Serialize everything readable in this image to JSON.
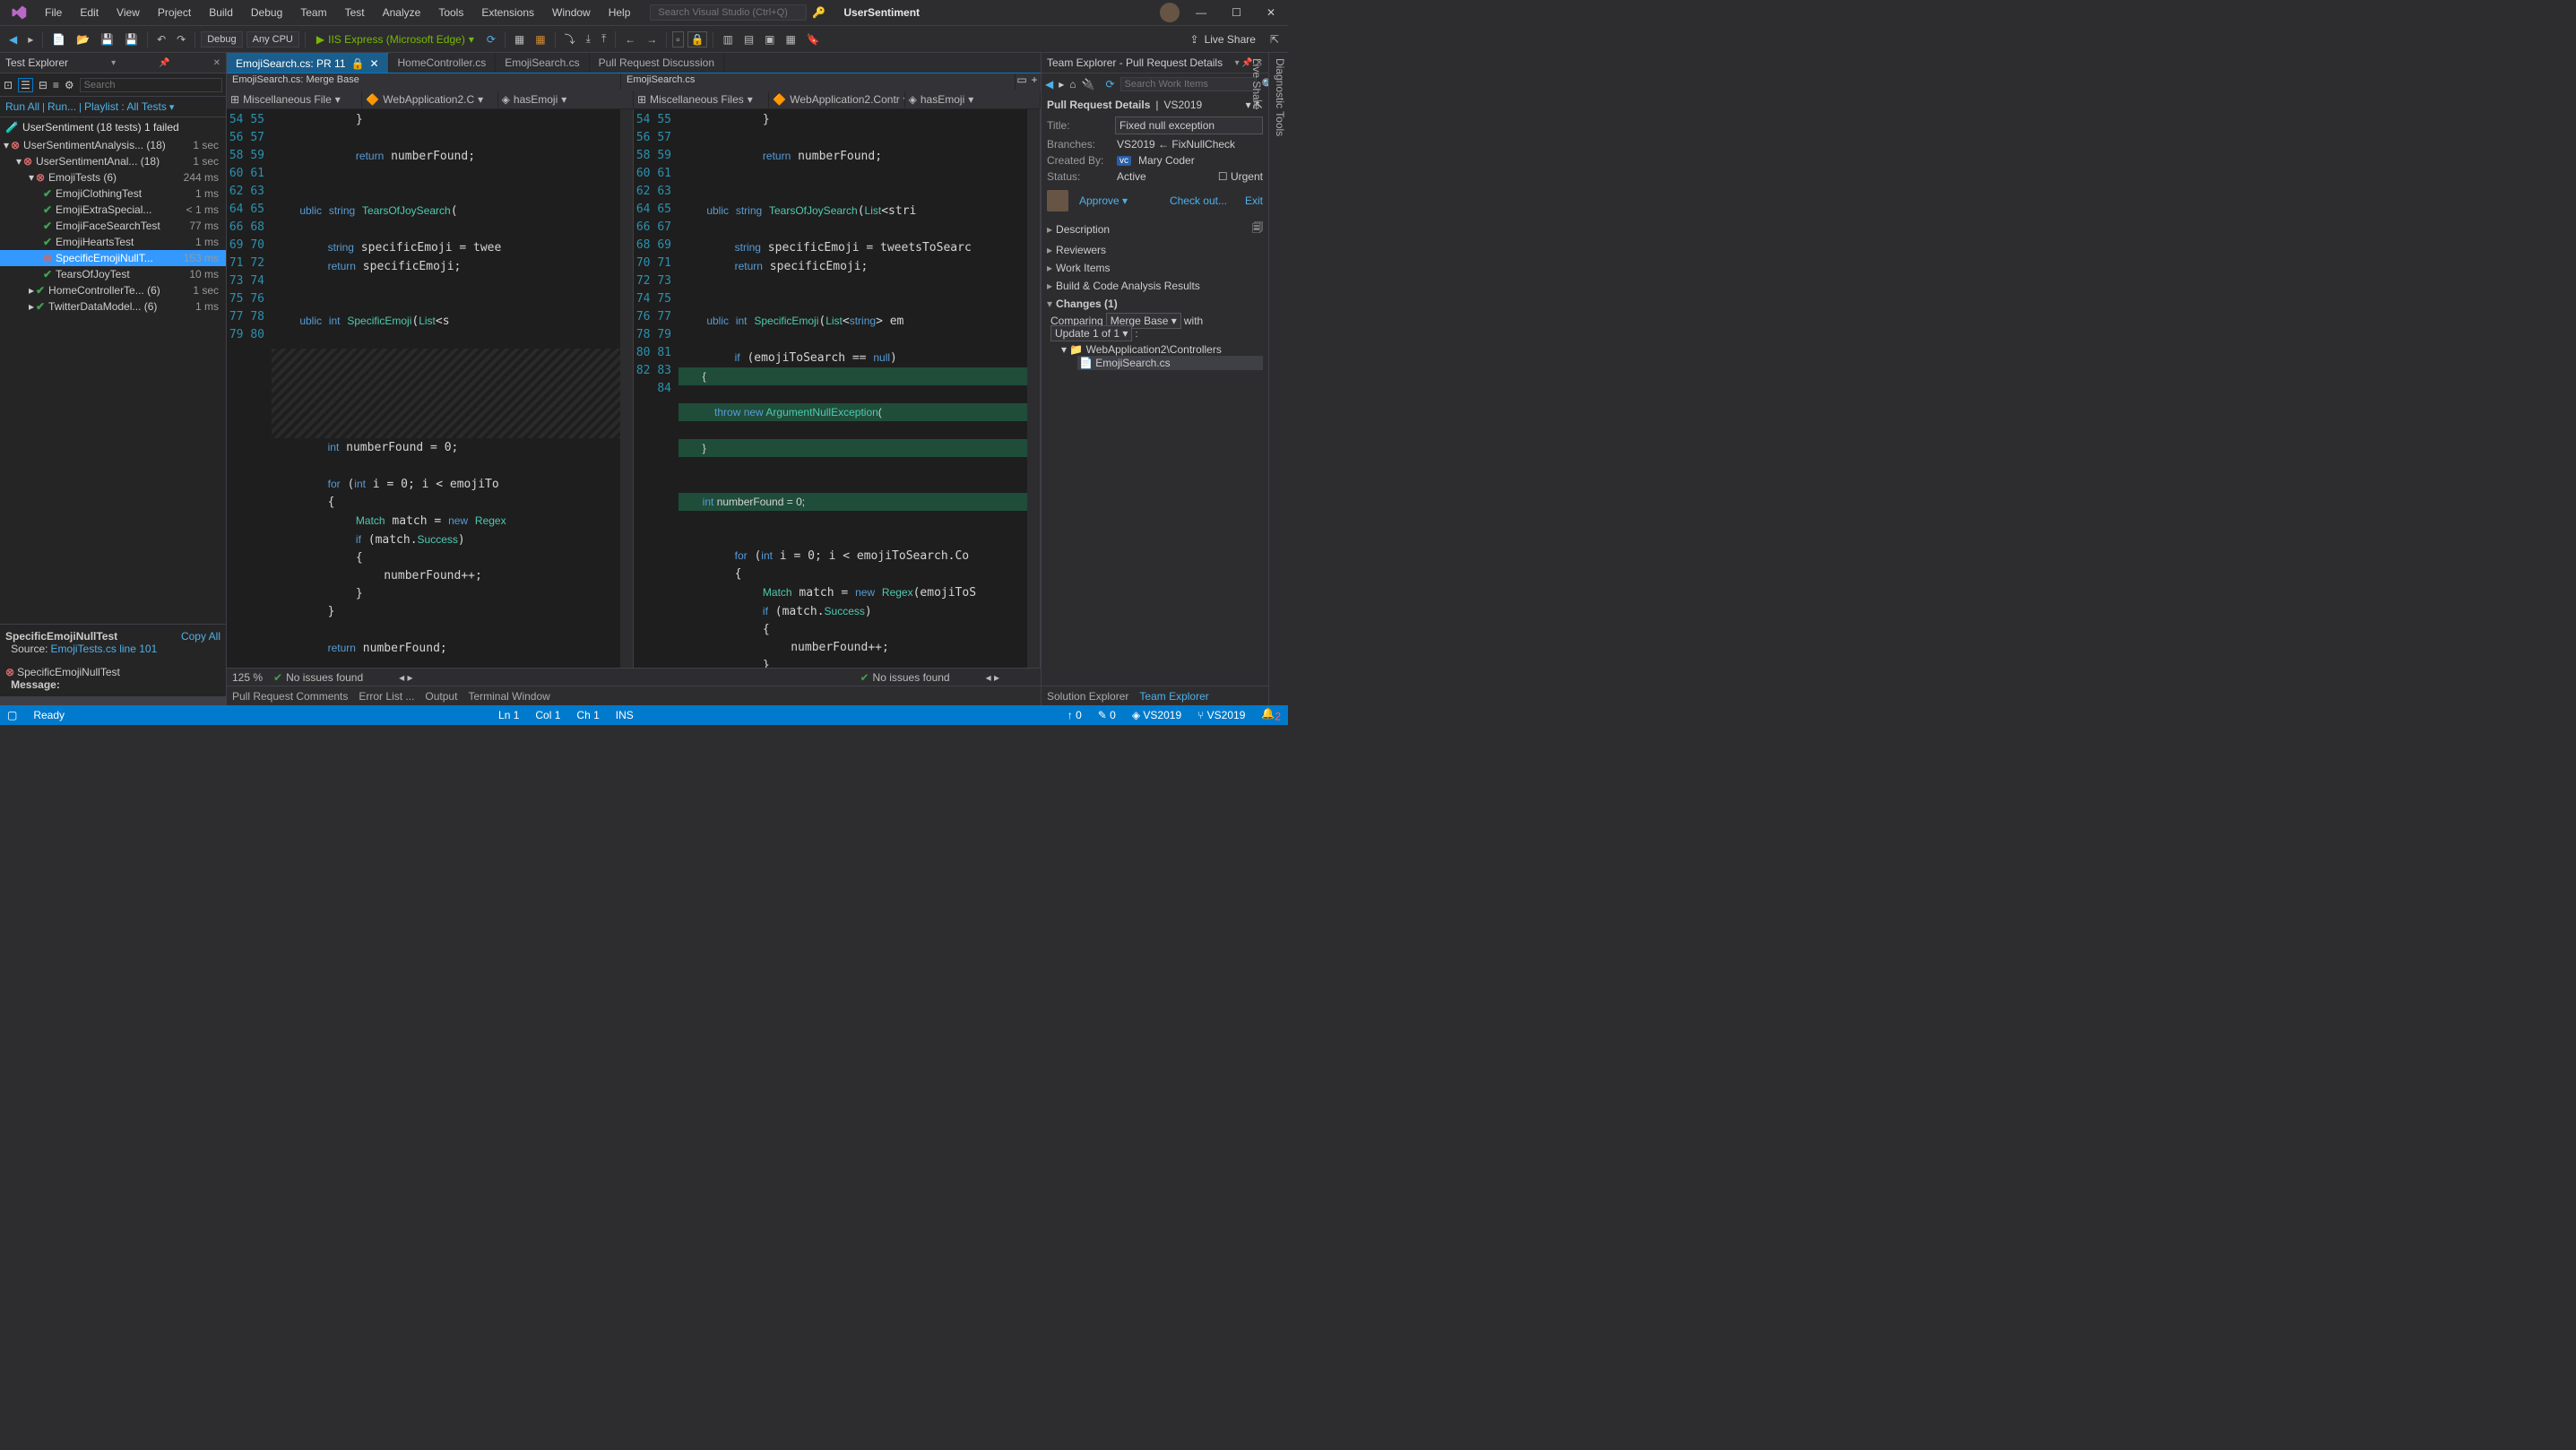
{
  "menu": {
    "file": "File",
    "edit": "Edit",
    "view": "View",
    "project": "Project",
    "build": "Build",
    "debug": "Debug",
    "team": "Team",
    "test": "Test",
    "analyze": "Analyze",
    "tools": "Tools",
    "extensions": "Extensions",
    "window": "Window",
    "help": "Help"
  },
  "search_placeholder": "Search Visual Studio (Ctrl+Q)",
  "project_name": "UserSentiment",
  "titlebar": {
    "min": "—",
    "max": "☐",
    "close": "✕"
  },
  "toolbar": {
    "config": "Debug",
    "platform": "Any CPU",
    "run": "IIS Express (Microsoft Edge)",
    "live": "Live Share"
  },
  "testex": {
    "title": "Test Explorer",
    "search_placeholder": "Search",
    "runall": "Run All",
    "run": "Run...",
    "playlist": "Playlist : All Tests",
    "summary": "UserSentiment (18 tests) 1 failed",
    "tree": [
      {
        "depth": 0,
        "icon": "fail",
        "label": "UserSentimentAnalysis... (18)",
        "time": "1 sec"
      },
      {
        "depth": 1,
        "icon": "fail",
        "label": "UserSentimentAnal... (18)",
        "time": "1 sec"
      },
      {
        "depth": 2,
        "icon": "fail",
        "label": "EmojiTests (6)",
        "time": "244 ms"
      },
      {
        "depth": 3,
        "icon": "pass",
        "label": "EmojiClothingTest",
        "time": "1 ms"
      },
      {
        "depth": 3,
        "icon": "pass",
        "label": "EmojiExtraSpecial...",
        "time": "< 1 ms"
      },
      {
        "depth": 3,
        "icon": "pass",
        "label": "EmojiFaceSearchTest",
        "time": "77 ms"
      },
      {
        "depth": 3,
        "icon": "pass",
        "label": "EmojiHeartsTest",
        "time": "1 ms"
      },
      {
        "depth": 3,
        "icon": "fail",
        "label": "SpecificEmojiNullT...",
        "time": "153 ms",
        "sel": true
      },
      {
        "depth": 3,
        "icon": "pass",
        "label": "TearsOfJoyTest",
        "time": "10 ms"
      },
      {
        "depth": 2,
        "icon": "pass",
        "label": "HomeControllerTe... (6)",
        "time": "1 sec",
        "collapsed": true
      },
      {
        "depth": 2,
        "icon": "pass",
        "label": "TwitterDataModel... (6)",
        "time": "1 ms",
        "collapsed": true
      }
    ],
    "detail": {
      "name": "SpecificEmojiNullTest",
      "copy": "Copy All",
      "source_lbl": "Source:",
      "source": "EmojiTests.cs line 101",
      "fail_name": "SpecificEmojiNullTest",
      "msg_lbl": "Message:"
    }
  },
  "tabs": [
    {
      "label": "EmojiSearch.cs: PR 11",
      "active": true,
      "lock": true,
      "close": true
    },
    {
      "label": "HomeController.cs"
    },
    {
      "label": "EmojiSearch.cs"
    },
    {
      "label": "Pull Request Discussion"
    }
  ],
  "subtabs": {
    "left": "EmojiSearch.cs: Merge Base",
    "right": "EmojiSearch.cs"
  },
  "nav": {
    "a": "Miscellaneous File",
    "b": "WebApplication2.C",
    "c": "hasEmoji",
    "d": "Miscellaneous Files",
    "e": "WebApplication2.Contr",
    "f": "hasEmoji"
  },
  "code_left": {
    "start": 54,
    "lines": [
      "            }",
      "",
      "            return numberFound;",
      "",
      "",
      "    ublic string TearsOfJoySearch(",
      "",
      "        string specificEmoji = twee",
      "        return specificEmoji;",
      "",
      "",
      "    ublic int SpecificEmoji(List<s",
      ""
    ],
    "break_after": 67,
    "resume": 68,
    "lines2": [
      "        int numberFound = 0;",
      "",
      "        for (int i = 0; i < emojiTo",
      "        {",
      "            Match match = new Regex",
      "            if (match.Success)",
      "            {",
      "                numberFound++;",
      "            }",
      "        }",
      "",
      "        return numberFound;",
      ""
    ]
  },
  "code_right": {
    "start": 54,
    "lines": [
      "            }",
      "",
      "            return numberFound;",
      "",
      "",
      "    ublic string TearsOfJoySearch(List<stri",
      "",
      "        string specificEmoji = tweetsToSearc",
      "        return specificEmoji;",
      "",
      "",
      "    ublic int SpecificEmoji(List<string> em",
      "",
      "        if (emojiToSearch == null)",
      "        {",
      "            throw new ArgumentNullException(",
      "        }",
      "",
      "        int numberFound = 0;",
      "",
      "        for (int i = 0; i < emojiToSearch.Co",
      "        {",
      "            Match match = new Regex(emojiToS",
      "            if (match.Success)",
      "            {",
      "                numberFound++;",
      "            }",
      "        }",
      "",
      "        return numberFound;",
      ""
    ],
    "added": [
      68,
      69,
      70,
      71,
      72
    ]
  },
  "edstatus": {
    "zoom": "125 %",
    "noissues": "No issues found"
  },
  "teamex": {
    "title": "Team Explorer - Pull Request Details",
    "search_placeholder": "Search Work Items",
    "heading": "Pull Request Details",
    "heading_branch": "VS2019",
    "title_lbl": "Title:",
    "title_val": "Fixed null exception",
    "branches_lbl": "Branches:",
    "branches_val": "VS2019 ← FixNullCheck",
    "created_lbl": "Created By:",
    "created_badge": "vc",
    "created_val": "Mary Coder",
    "status_lbl": "Status:",
    "status_val": "Active",
    "urgent": "Urgent",
    "approve": "Approve",
    "checkout": "Check out...",
    "exit": "Exit",
    "acc": [
      "Description",
      "Reviewers",
      "Work Items",
      "Build & Code Analysis Results"
    ],
    "changes": "Changes (1)",
    "comparing": "Comparing",
    "merge": "Merge Base",
    "with": "with",
    "update": "Update 1 of 1",
    "folder": "WebApplication2\\Controllers",
    "file": "EmojiSearch.cs"
  },
  "bottomtabs": {
    "prc": "Pull Request Comments",
    "err": "Error List ...",
    "out": "Output",
    "term": "Terminal Window",
    "sol": "Solution Explorer",
    "team": "Team Explorer"
  },
  "status": {
    "ready": "Ready",
    "ln": "Ln 1",
    "col": "Col 1",
    "ch": "Ch 1",
    "ins": "INS",
    "up": "↑ 0",
    "pen": "✎ 0",
    "repo": "VS2019",
    "branch": "VS2019",
    "bell": "2"
  },
  "rsidetabs": {
    "diag": "Diagnostic Tools",
    "live": "Live Share"
  }
}
